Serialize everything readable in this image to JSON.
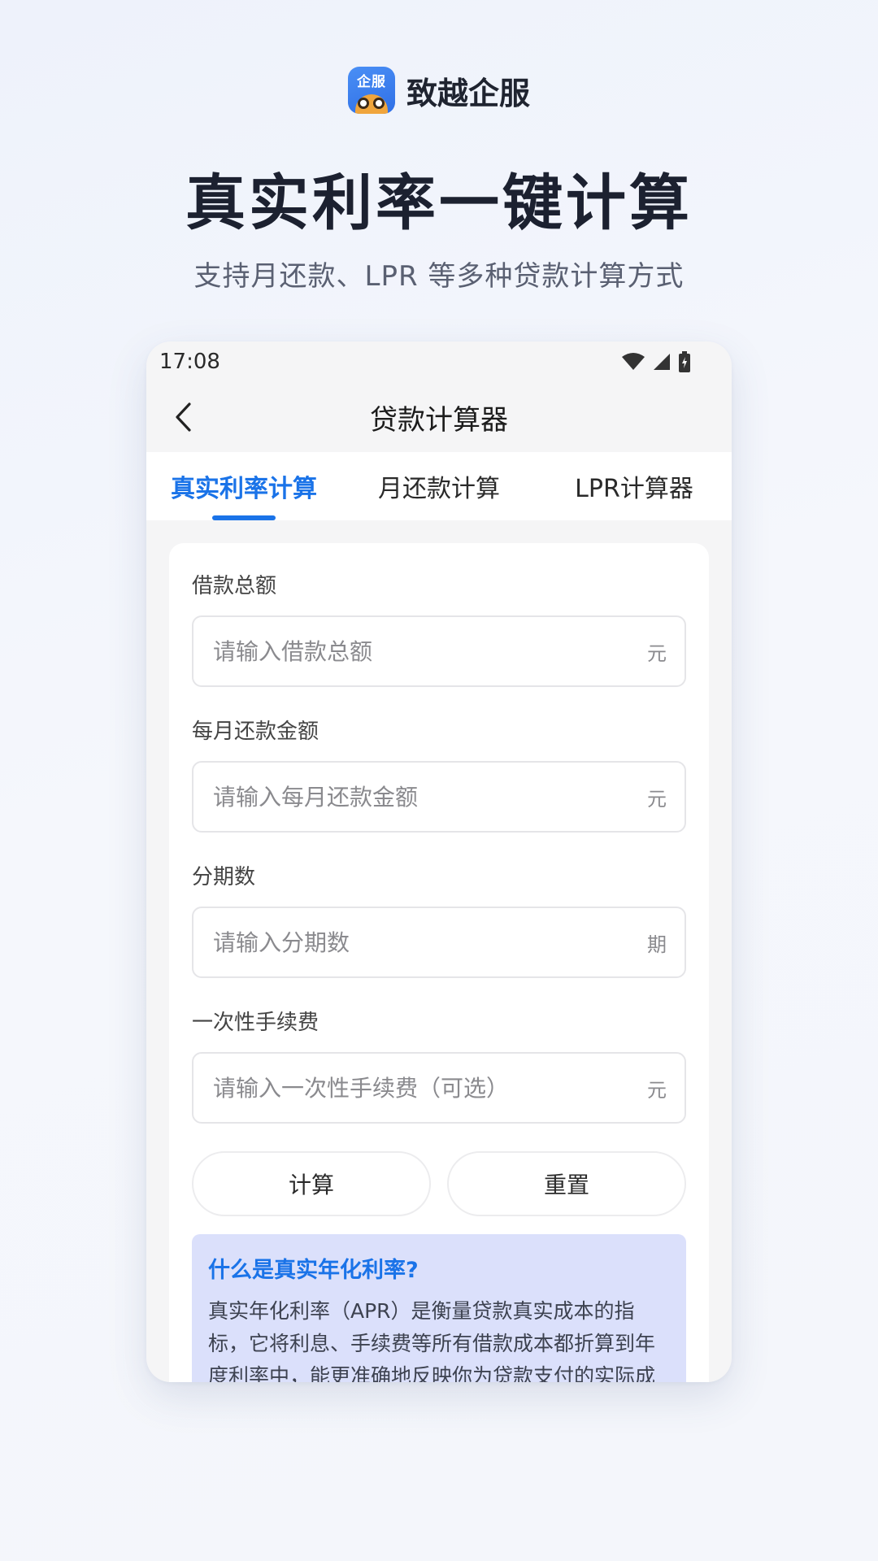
{
  "promo": {
    "brand_logo_text": "企服",
    "brand_name": "致越企服",
    "headline": "真实利率一键计算",
    "subline": "支持月还款、LPR 等多种贷款计算方式"
  },
  "status_bar": {
    "time": "17:08"
  },
  "navbar": {
    "title": "贷款计算器"
  },
  "tabs": [
    {
      "label": "真实利率计算",
      "active": true
    },
    {
      "label": "月还款计算",
      "active": false
    },
    {
      "label": "LPR计算器",
      "active": false
    }
  ],
  "form": {
    "fields": [
      {
        "label": "借款总额",
        "placeholder": "请输入借款总额",
        "value": "",
        "unit": "元"
      },
      {
        "label": "每月还款金额",
        "placeholder": "请输入每月还款金额",
        "value": "",
        "unit": "元"
      },
      {
        "label": "分期数",
        "placeholder": "请输入分期数",
        "value": "",
        "unit": "期"
      },
      {
        "label": "一次性手续费",
        "placeholder": "请输入一次性手续费（可选）",
        "value": "",
        "unit": "元"
      }
    ],
    "calculate_label": "计算",
    "reset_label": "重置"
  },
  "info": {
    "title": "什么是真实年化利率?",
    "body": "真实年化利率（APR）是衡量贷款真实成本的指标，它将利息、手续费等所有借款成本都折算到年度利率中，能更准确地反映你为贷款支付的实际成本。"
  },
  "colors": {
    "accent": "#1a73e8",
    "info_bg": "#dbe0fb"
  },
  "icons": {
    "back": "chevron-left-icon",
    "wifi": "wifi-icon",
    "signal": "signal-icon",
    "battery": "battery-icon"
  }
}
